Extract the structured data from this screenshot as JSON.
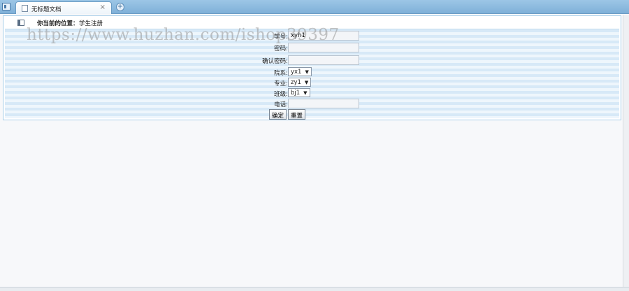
{
  "browser": {
    "tab_title": "无标题文档",
    "tab_close": "×",
    "new_tab": "+"
  },
  "location": {
    "label": "你当前的位置：",
    "value": "学生注册"
  },
  "form": {
    "student_id": {
      "label": "学号:",
      "value": "xyh1"
    },
    "password": {
      "label": "密码:",
      "value": ""
    },
    "confirm_password": {
      "label": "确认密码:",
      "value": ""
    },
    "department": {
      "label": "院系:",
      "selected": "yx1"
    },
    "major": {
      "label": "专业:",
      "selected": "zy1"
    },
    "class": {
      "label": "班级:",
      "selected": "bj1"
    },
    "phone": {
      "label": "电话:",
      "value": ""
    },
    "confirm_label": "确定",
    "reset_label": "重置"
  },
  "watermark": "https://www.huzhan.com/ishop39397"
}
